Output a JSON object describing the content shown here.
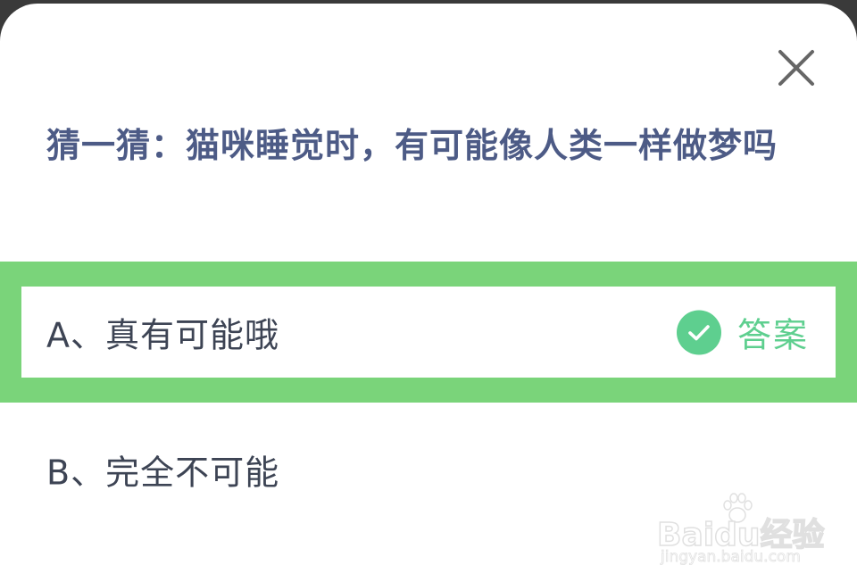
{
  "quiz": {
    "question": "猜一猜：猫咪睡觉时，有可能像人类一样做梦吗",
    "options": [
      {
        "label": "A、真有可能哦",
        "is_answer": true
      },
      {
        "label": "B、完全不可能",
        "is_answer": false
      }
    ],
    "answer_label": "答案",
    "close_icon": "close-icon",
    "check_icon": "check-circle-icon"
  },
  "watermark": {
    "logo": "Baidu经验",
    "url": "jingyan.baidu.com"
  },
  "colors": {
    "question_text": "#4d5b86",
    "option_text": "#3d4454",
    "correct_highlight": "#7ad47a",
    "answer_green": "#5ecf8f"
  }
}
